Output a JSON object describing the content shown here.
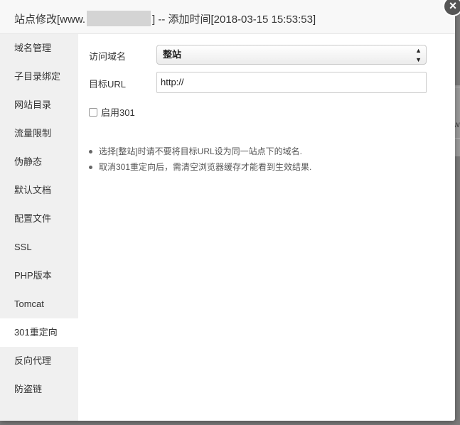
{
  "dialog": {
    "title_prefix": "站点修改[www.",
    "title_suffix": "] -- 添加时间[2018-03-15 15:53:53]"
  },
  "sidebar": {
    "items": [
      {
        "label": "域名管理"
      },
      {
        "label": "子目录绑定"
      },
      {
        "label": "网站目录"
      },
      {
        "label": "流量限制"
      },
      {
        "label": "伪静态"
      },
      {
        "label": "默认文档"
      },
      {
        "label": "配置文件"
      },
      {
        "label": "SSL"
      },
      {
        "label": "PHP版本"
      },
      {
        "label": "Tomcat"
      },
      {
        "label": "301重定向",
        "active": true
      },
      {
        "label": "反向代理"
      },
      {
        "label": "防盗链"
      }
    ]
  },
  "form": {
    "domain_label": "访问域名",
    "domain_selected": "整站",
    "target_label": "目标URL",
    "target_value": "http://",
    "enable_label": "启用301"
  },
  "notes": [
    "选择[整站]时请不要将目标URL设为同一站点下的域名.",
    "取消301重定向后，需清空浏览器缓存才能看到生效结果."
  ],
  "backdrop": {
    "edge_char": "w"
  },
  "colors": {
    "sidebar_bg": "#f0f0f0",
    "title_bg": "#f8f8f8",
    "close_bg": "#555555"
  },
  "icons": {
    "close": "close-icon",
    "select_arrows": "chevron-updown-icon"
  }
}
